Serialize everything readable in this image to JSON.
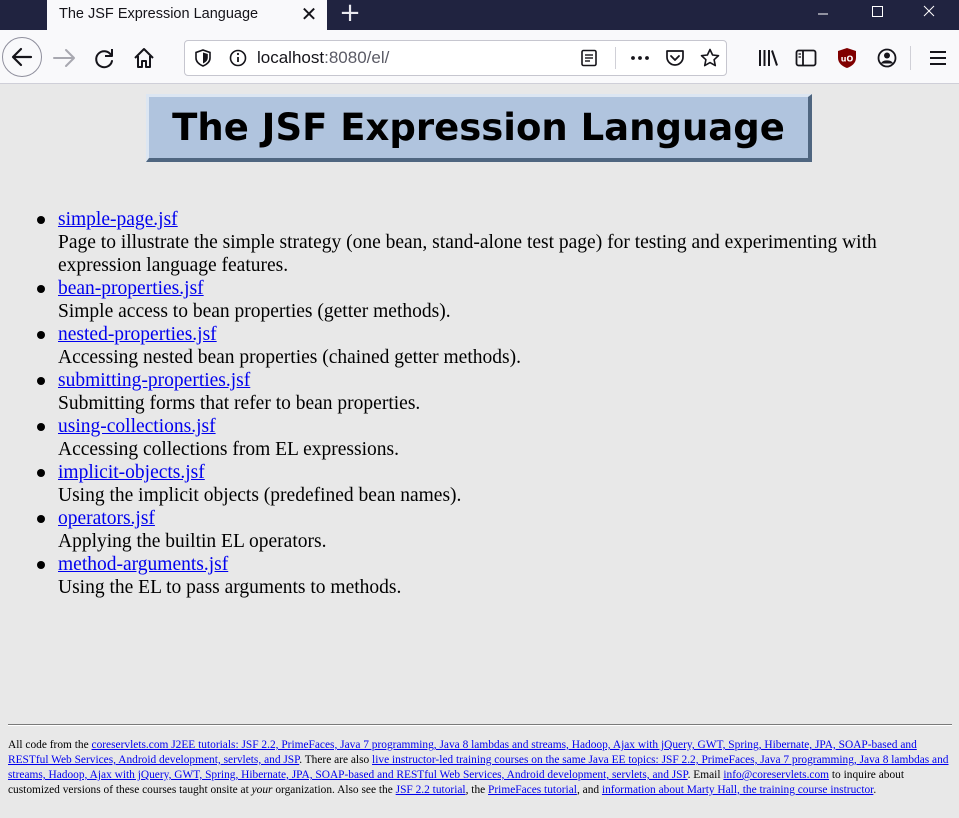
{
  "browser": {
    "tab_title": "The JSF Expression Language",
    "tab_close": "✕",
    "new_tab": "+",
    "url_host": "localhost",
    "url_rest": ":8080/el/",
    "icons": [
      "back-icon",
      "forward-icon",
      "reload-icon",
      "home-icon",
      "shield-icon",
      "info-icon",
      "reader-view-icon",
      "more-icon",
      "pocket-icon",
      "bookmark-star-icon",
      "library-icon",
      "sidebar-icon",
      "ublock-icon",
      "account-icon",
      "menu-icon"
    ]
  },
  "page": {
    "title": "The JSF Expression Language",
    "items": [
      {
        "link": "simple-page.jsf",
        "desc": "Page to illustrate the simple strategy (one bean, stand-alone test page) for testing and experimenting with expression language features."
      },
      {
        "link": "bean-properties.jsf",
        "desc": "Simple access to bean properties (getter methods)."
      },
      {
        "link": "nested-properties.jsf",
        "desc": "Accessing nested bean properties (chained getter methods)."
      },
      {
        "link": "submitting-properties.jsf",
        "desc": "Submitting forms that refer to bean properties."
      },
      {
        "link": "using-collections.jsf",
        "desc": "Accessing collections from EL expressions."
      },
      {
        "link": "implicit-objects.jsf",
        "desc": "Using the implicit objects (predefined bean names)."
      },
      {
        "link": "operators.jsf",
        "desc": "Applying the builtin EL operators."
      },
      {
        "link": "method-arguments.jsf",
        "desc": "Using the EL to pass arguments to methods."
      }
    ]
  },
  "footer": {
    "t1": "All code from the ",
    "l1": "coreservlets.com J2EE tutorials: JSF 2.2, PrimeFaces, Java 7 programming, Java 8 lambdas and streams, Hadoop, Ajax with jQuery, GWT, Spring, Hibernate, JPA, SOAP-based and RESTful Web Services, Android development, servlets, and JSP",
    "t2": ". There are also ",
    "l2": "live instructor-led training courses on the same Java EE topics: JSF 2.2, PrimeFaces, Java 7 programming, Java 8 lambdas and streams, Hadoop, Ajax with jQuery, GWT, Spring, Hibernate, JPA, SOAP-based and RESTful Web Services, Android development, servlets, and JSP",
    "t3": ". Email ",
    "l3": "info@coreservlets.com",
    "t4": " to inquire about customized versions of these courses taught onsite at ",
    "t5": "your",
    "t6": " organization. Also see the ",
    "l4": "JSF 2.2 tutorial",
    "t7": ", the ",
    "l5": "PrimeFaces tutorial",
    "t8": ", and ",
    "l6": "information about Marty Hall, the training course instructor",
    "t9": "."
  }
}
